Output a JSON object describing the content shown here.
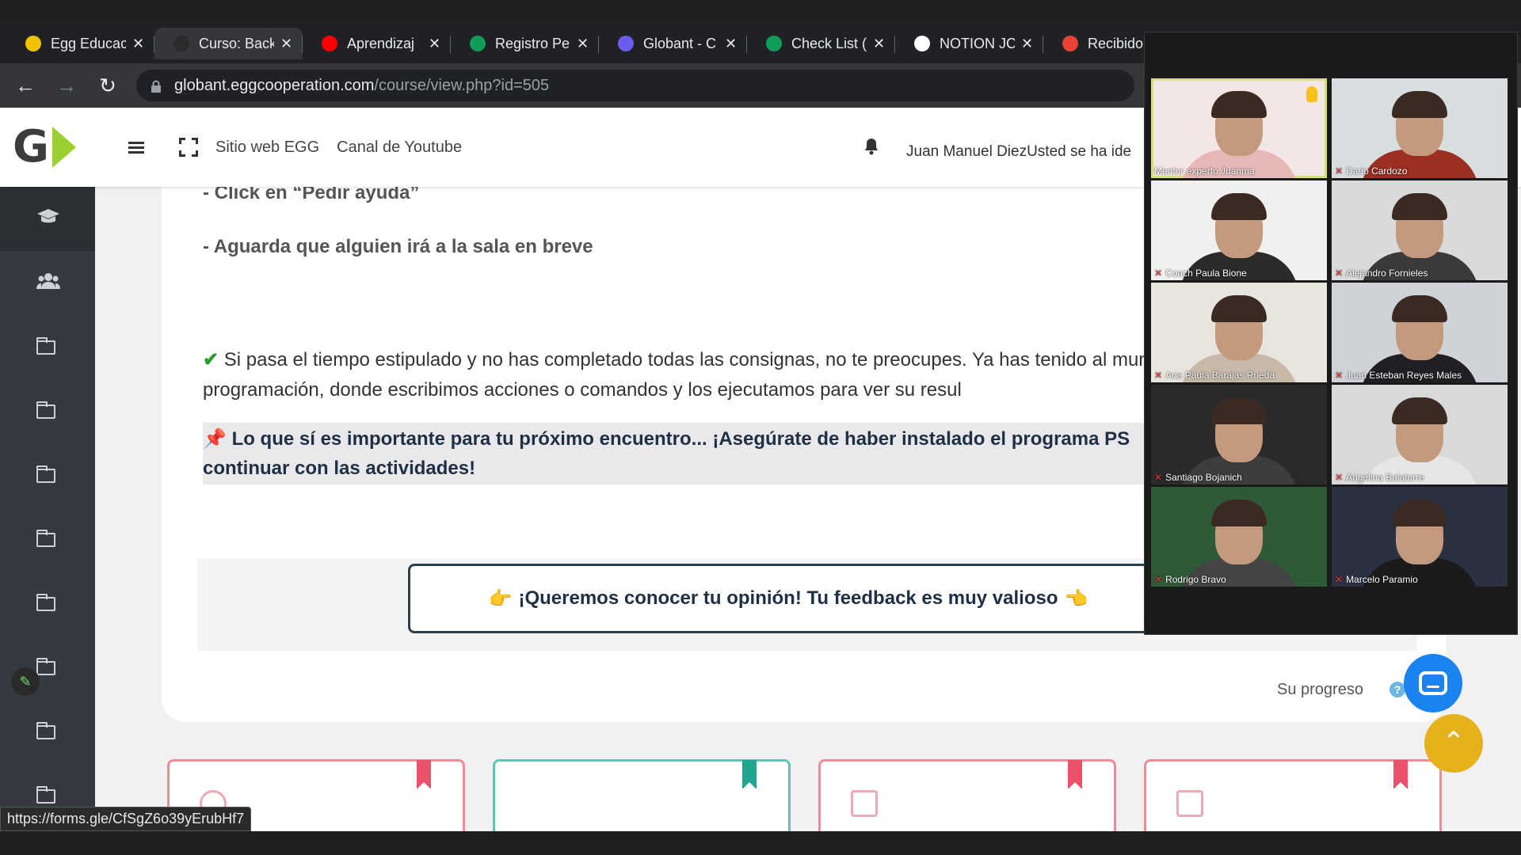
{
  "browser": {
    "tabs": [
      {
        "title": "Egg Educac",
        "favicon_color": "#f2c200",
        "active": false
      },
      {
        "title": "Curso: Back",
        "favicon_color": "#2b2b2b",
        "active": true
      },
      {
        "title": "Aprendizaj",
        "favicon_color": "#ff0000",
        "active": false
      },
      {
        "title": "Registro Pe",
        "favicon_color": "#0f9d58",
        "active": false
      },
      {
        "title": "Globant - C",
        "favicon_color": "#6b5cf0",
        "active": false
      },
      {
        "title": "Check List (",
        "favicon_color": "#0f9d58",
        "active": false
      },
      {
        "title": "NOTION JC",
        "favicon_color": "#ffffff",
        "active": false
      },
      {
        "title": "Recibido",
        "favicon_color": "#ea4335",
        "active": false
      }
    ],
    "url_host": "globant.eggcooperation.com",
    "url_path": "/course/view.php?id=505",
    "status_url": "https://forms.gle/CfSgZ6o39yErubHf7"
  },
  "header": {
    "links": [
      "Sitio web EGG",
      "Canal de Youtube"
    ],
    "user_text": "Juan Manuel DiezUsted se ha ide"
  },
  "content": {
    "step_help": "- Click en “Pedir ayuda”",
    "step_wait": "- Aguarda que alguien irá a la sala en breve",
    "paragraph": "Si pasa el tiempo estipulado y no has completado todas las consignas, no te preocupes. Ya has tenido al mundo de la programación, donde escribimos acciones o comandos y los ejecutamos para ver su resul",
    "highlight": "Lo que sí es importante para tu próximo encuentro... ¡Asegúrate de haber instalado el programa PS continuar con las actividades!",
    "feedback_button": "¡Queremos conocer tu opinión! Tu feedback es muy valioso",
    "progress_label": "Su progreso",
    "help_glyph": "?"
  },
  "sidebar": {
    "icons": [
      "graduation-cap-icon",
      "users-icon",
      "folder-icon",
      "folder-icon",
      "folder-icon",
      "folder-icon",
      "folder-icon",
      "folder-icon",
      "folder-icon",
      "folder-icon"
    ]
  },
  "call": {
    "participants": [
      {
        "name": "Mentor experto Juanma",
        "muted": false,
        "speaking": true,
        "hand_raised": true,
        "bg": "#f5e6e6",
        "shirt": "#e7b7b7"
      },
      {
        "name": "Dario Cardozo",
        "muted": true,
        "speaking": false,
        "hand_raised": false,
        "bg": "#d8dde0",
        "shirt": "#9b2f22"
      },
      {
        "name": "Coach Paula Bione",
        "muted": true,
        "speaking": false,
        "hand_raised": false,
        "bg": "#f0f0ee",
        "shirt": "#2b2b2b"
      },
      {
        "name": "Alejandro Fornieles",
        "muted": true,
        "speaking": false,
        "hand_raised": false,
        "bg": "#d9dadc",
        "shirt": "#3a3a3a"
      },
      {
        "name": "Ana Paula Barajas Rueda",
        "muted": true,
        "speaking": false,
        "hand_raised": false,
        "bg": "#e8e4de",
        "shirt": "#c7b9a9"
      },
      {
        "name": "Juan Esteban Reyes Males",
        "muted": true,
        "speaking": false,
        "hand_raised": false,
        "bg": "#cfd2d6",
        "shirt": "#1f1f24"
      },
      {
        "name": "Santiago Bojanich",
        "muted": true,
        "speaking": false,
        "hand_raised": false,
        "bg": "#2a2a2a",
        "shirt": "#3d3d3d"
      },
      {
        "name": "Angelina Balatorre",
        "muted": true,
        "speaking": false,
        "hand_raised": false,
        "bg": "#d8dad9",
        "shirt": "#e6e6e6"
      },
      {
        "name": "Rodrigo Bravo",
        "muted": true,
        "speaking": false,
        "hand_raised": false,
        "bg": "#2f5a37",
        "shirt": "#444"
      },
      {
        "name": "Marcelo Paramio",
        "muted": true,
        "speaking": false,
        "hand_raised": false,
        "bg": "#2c3142",
        "shirt": "#1b1b1b"
      }
    ]
  },
  "colors": {
    "brand_green": "#9bd02d",
    "accent_yellow": "#e7b11c",
    "chat_blue": "#1b83f0"
  }
}
